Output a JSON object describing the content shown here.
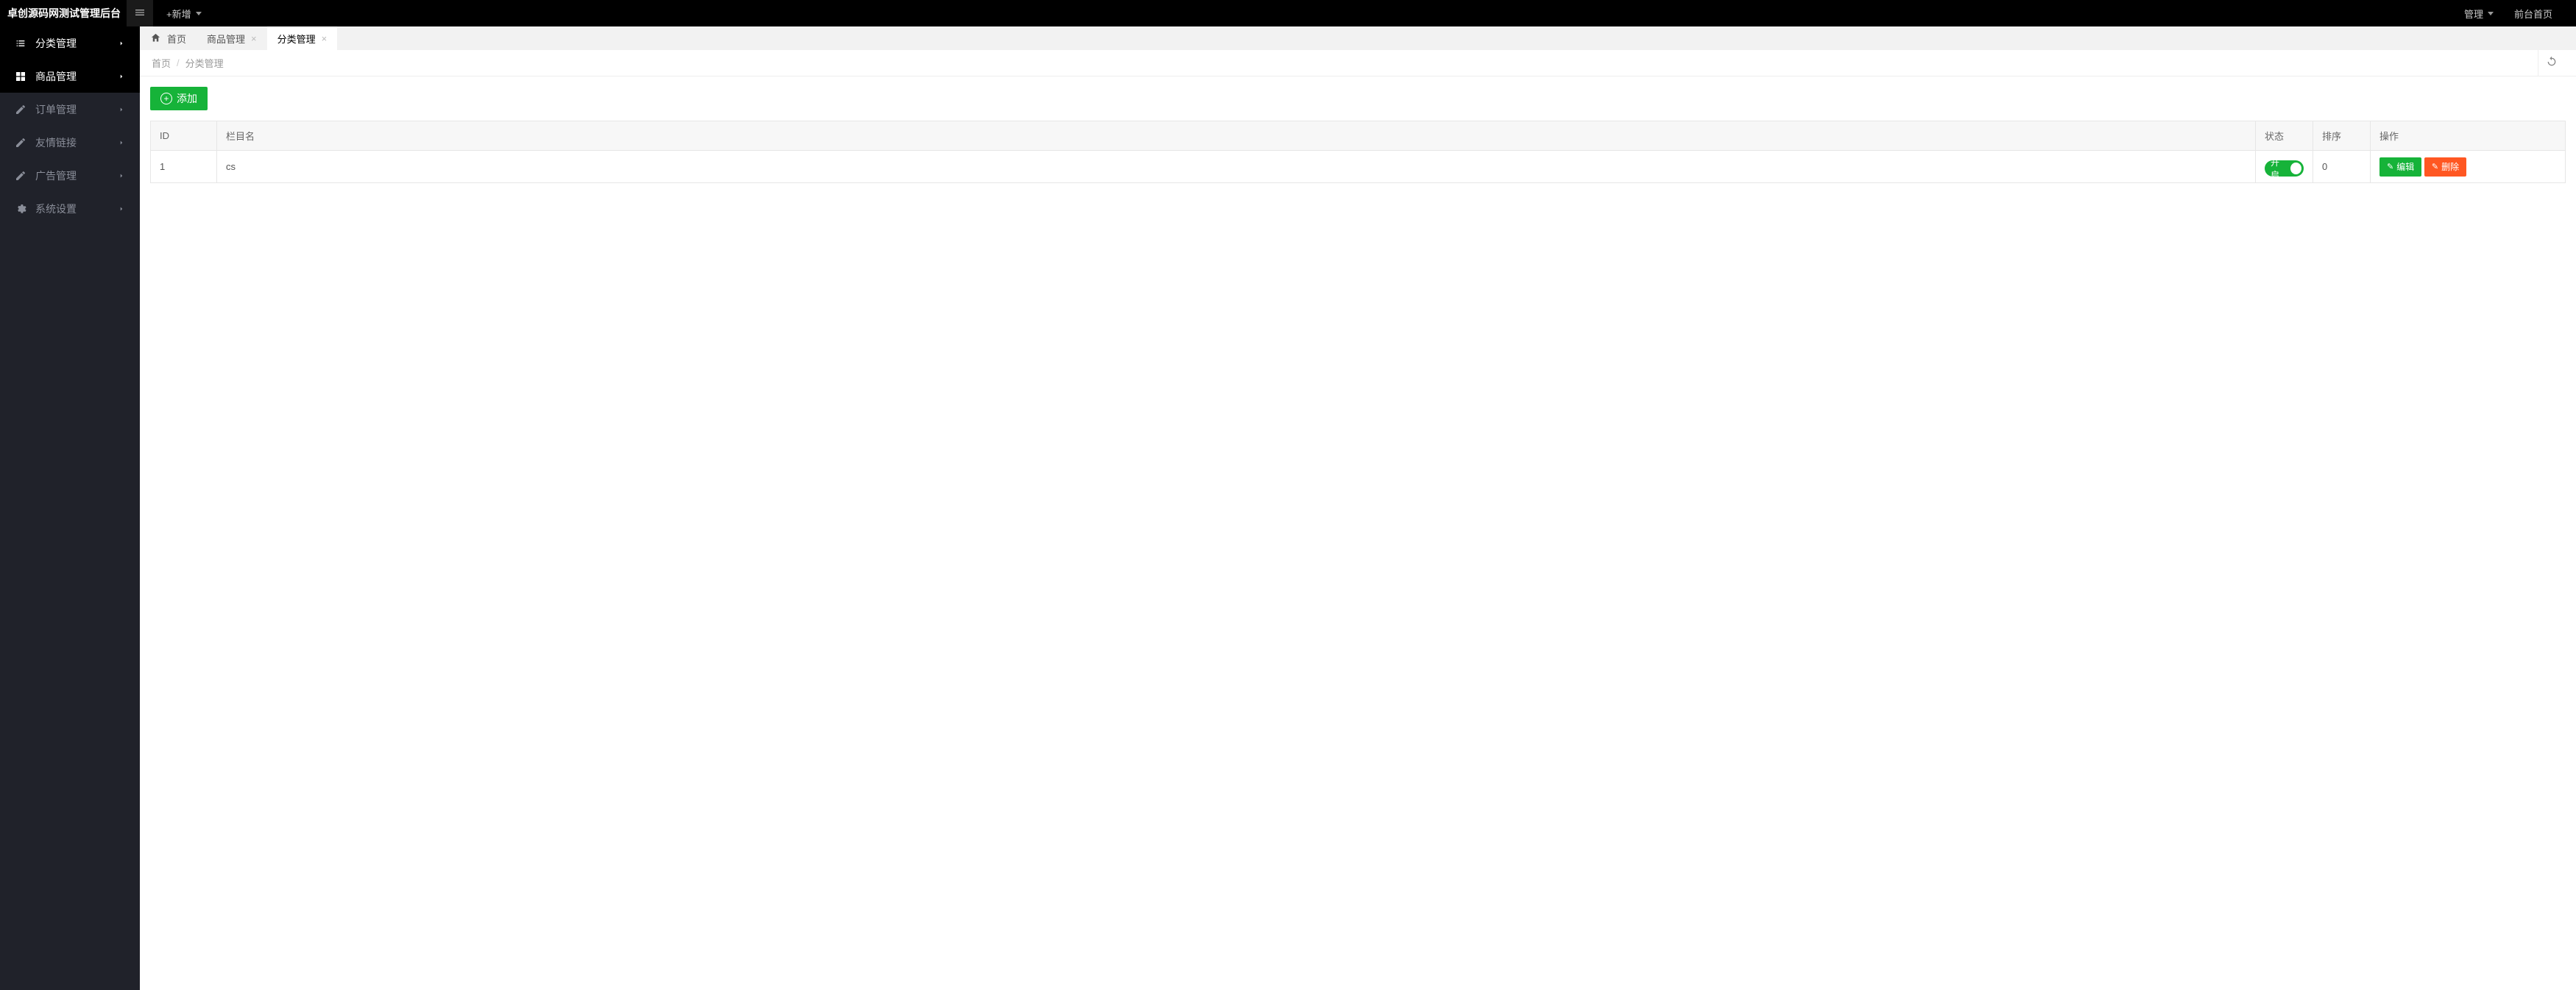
{
  "header": {
    "logo": "卓创源码网测试管理后台",
    "add_new_label": "+新增",
    "admin_label": "管理",
    "front_home_label": "前台首页"
  },
  "sidebar": {
    "items": [
      {
        "label": "分类管理",
        "icon": "list-icon",
        "active": true
      },
      {
        "label": "商品管理",
        "icon": "grid-icon",
        "active": true
      },
      {
        "label": "订单管理",
        "icon": "edit-box-icon",
        "active": false
      },
      {
        "label": "友情链接",
        "icon": "edit-box-icon",
        "active": false
      },
      {
        "label": "广告管理",
        "icon": "edit-box-icon",
        "active": false
      },
      {
        "label": "系统设置",
        "icon": "gear-icon",
        "active": false
      }
    ]
  },
  "tabs": [
    {
      "label": "首页",
      "home": true,
      "closable": false,
      "active": false
    },
    {
      "label": "商品管理",
      "home": false,
      "closable": true,
      "active": false
    },
    {
      "label": "分类管理",
      "home": false,
      "closable": true,
      "active": true
    }
  ],
  "breadcrumb": {
    "home": "首页",
    "current": "分类管理"
  },
  "buttons": {
    "add": "添加",
    "edit": "编辑",
    "delete": "删除"
  },
  "table": {
    "headers": {
      "id": "ID",
      "name": "栏目名",
      "status": "状态",
      "sort": "排序",
      "ops": "操作"
    },
    "rows": [
      {
        "id": "1",
        "name": "cs",
        "status_label": "开启",
        "sort": "0"
      }
    ]
  }
}
